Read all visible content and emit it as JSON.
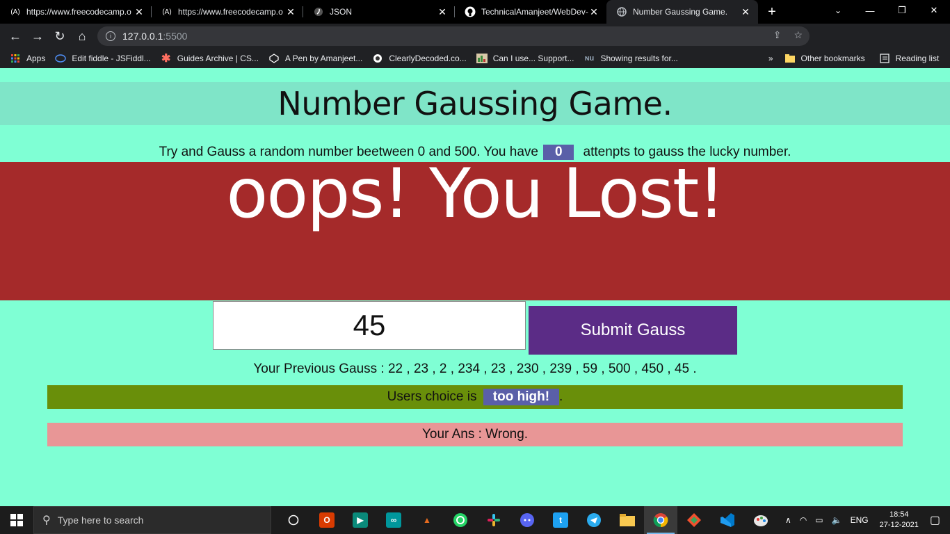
{
  "browser": {
    "tabs": [
      {
        "title": "https://www.freecodecamp.o",
        "favicon": "(A)"
      },
      {
        "title": "https://www.freecodecamp.o",
        "favicon": "(A)"
      },
      {
        "title": "JSON",
        "favicon": "J"
      },
      {
        "title": "TechnicalAmanjeet/WebDev-",
        "favicon": "GH"
      },
      {
        "title": "Number Gaussing Game.",
        "favicon": "globe",
        "active": true
      }
    ],
    "url_host": "127.0.0.1",
    "url_port": ":5500",
    "bookmarks": [
      {
        "label": "Apps"
      },
      {
        "label": "Edit fiddle - JSFiddl..."
      },
      {
        "label": "Guides Archive | CS..."
      },
      {
        "label": "A Pen by Amanjeet..."
      },
      {
        "label": "ClearlyDecoded.co..."
      },
      {
        "label": "Can I use... Support..."
      },
      {
        "label": "Showing results for..."
      }
    ],
    "more_bookmarks": "»",
    "other_bookmarks": "Other bookmarks",
    "reading_list": "Reading list"
  },
  "game": {
    "title": "Number Gaussing Game.",
    "instruction_before": "Try and Gauss a random number beetween 0 and 500. You have",
    "attempts": "0",
    "instruction_after": "attenpts to gauss the lucky number.",
    "lost_message": "oops! You Lost!",
    "input_value": "45",
    "submit_label": "Submit Gauss",
    "previous_guesses": "Your Previous Gauss : 22 , 23 , 2 , 234 , 23 , 230 , 239 , 59 , 500 , 450 , 45 .",
    "choice_prefix": "Users choice is",
    "choice_value": "too high!",
    "choice_suffix": ".",
    "answer": "Your Ans : Wrong."
  },
  "colors": {
    "page_bg": "#7fffd4",
    "title_bar": "#7fe5c8",
    "lost_banner": "#a52a2a",
    "submit": "#5b2c86",
    "choice_bar": "#698f0a",
    "answer_bar": "#e89696",
    "badge": "#5a5fa8"
  },
  "taskbar": {
    "search_placeholder": "Type here to search",
    "language": "ENG",
    "time": "18:54",
    "date": "27-12-2021"
  }
}
